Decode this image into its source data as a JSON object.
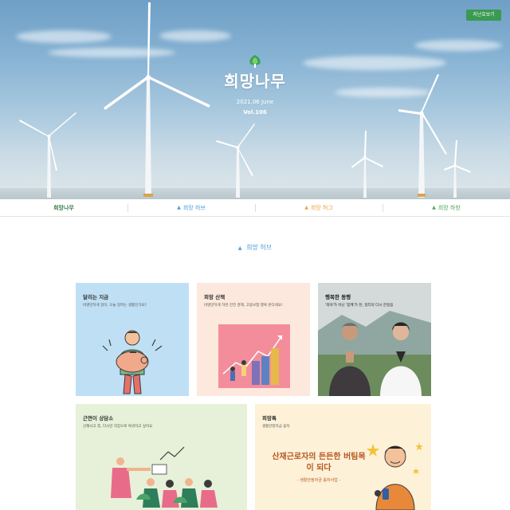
{
  "hero": {
    "logo_text": "희망나무",
    "issue_date": "2021.06 June",
    "issue_vol": "Vol.106",
    "prev_button": "지난호보기"
  },
  "nav": {
    "brand": "희망나무",
    "items": [
      {
        "label": "희망 허브",
        "color": "#4a9bd6"
      },
      {
        "label": "희망 허그",
        "color": "#e8a23a"
      },
      {
        "label": "희망 하방",
        "color": "#49a55a"
      }
    ]
  },
  "section": {
    "title": "희망 허브"
  },
  "cards": [
    {
      "label": "달리는 지금",
      "desc": "비명만하게 일이, 오늘 달려는 생활인가요?"
    },
    {
      "label": "희망 산책",
      "desc": "비명만하게 하면 안전 경제, 고용보험 행복 온다네요!"
    },
    {
      "label": "행복한 동행",
      "desc": "'희야'가 아닌 '함께'가 된, 일터의 다시 한걸음"
    },
    {
      "label": "근면이 상담소",
      "desc": "산재사고 후, 다시만 직장으로 복귀하고 싶어요"
    },
    {
      "label": "희망톡",
      "desc": "생활안정자금 융자",
      "slogan": "산재근로자의 든든한 버팀목이 되다",
      "slogan_sub": "- 생활안정자금 융자사업 -"
    }
  ],
  "colors": {
    "accent_blue": "#4a9bd6",
    "accent_orange": "#e8a23a",
    "accent_green": "#49a55a",
    "prev_button_bg": "#3a9a52"
  }
}
